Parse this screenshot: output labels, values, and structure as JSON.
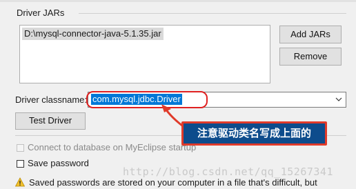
{
  "group": {
    "label": "Driver JARs"
  },
  "jars": {
    "items": [
      "D:\\mysql-connector-java-5.1.35.jar"
    ]
  },
  "buttons": {
    "add_jars": "Add JARs",
    "remove": "Remove",
    "test_driver": "Test Driver"
  },
  "driver_class": {
    "label": "Driver classname:",
    "value": "com.mysql.jdbc.Driver"
  },
  "options": {
    "connect_label": "Connect to database on MyEclipse startup",
    "connect_checked": false,
    "connect_enabled": false,
    "save_password_label": "Save password",
    "save_password_checked": false
  },
  "warning": {
    "text": "Saved passwords are stored on your computer in a file that's difficult, but"
  },
  "annotation": {
    "text": "注意驱动类名写成上面的"
  },
  "watermark": {
    "text": "http://blog.csdn.net/qq_15267341"
  },
  "colors": {
    "selection": "#0078d7",
    "callout_bg": "#0d4c8c",
    "callout_border": "#e03a2a",
    "highlight_ring": "#e02020"
  }
}
